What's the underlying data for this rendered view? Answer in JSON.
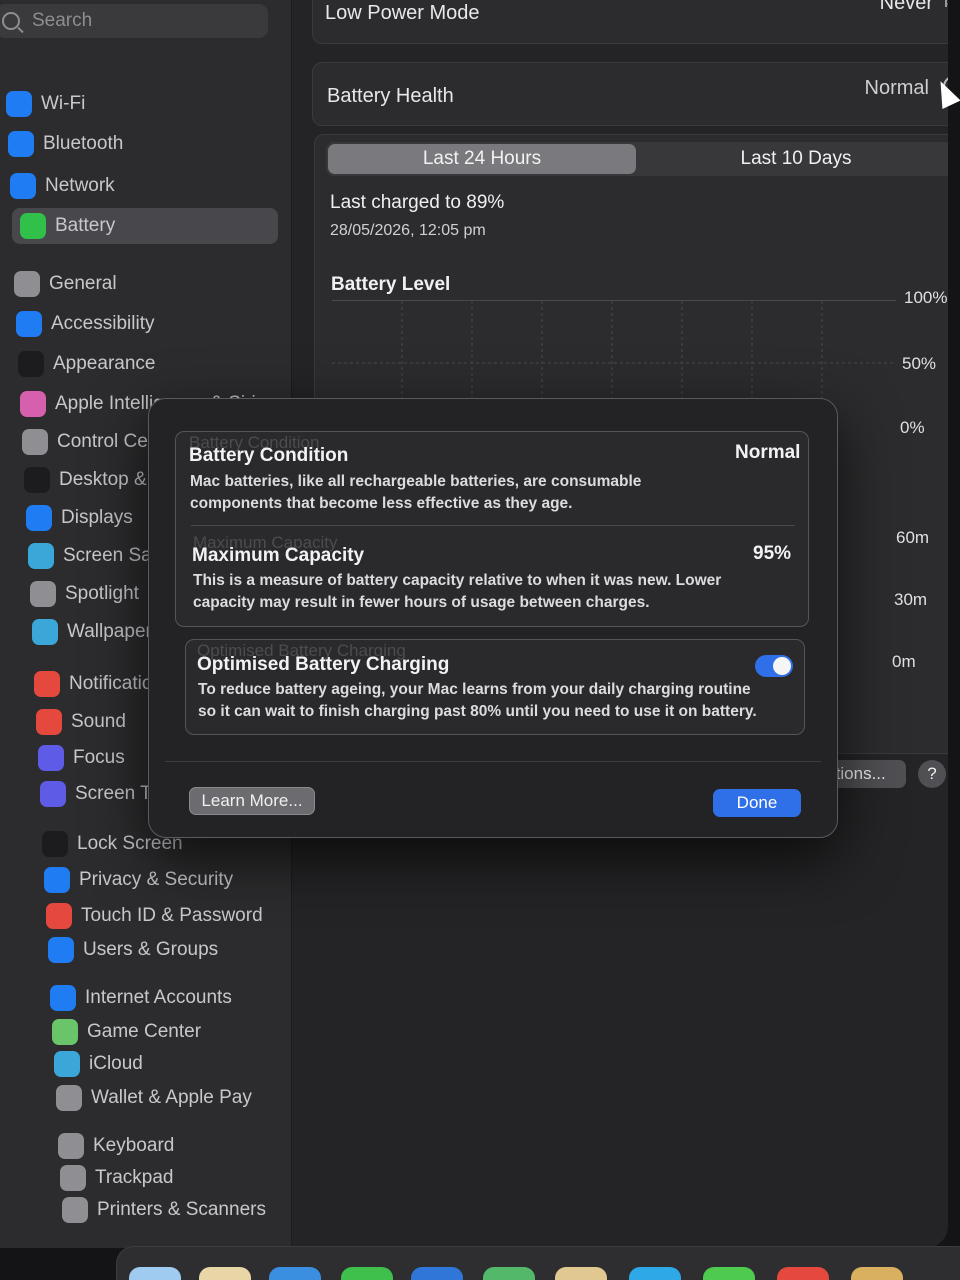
{
  "sidebar": {
    "search_placeholder": "Search",
    "items": [
      {
        "label": "Wi-Fi",
        "icon": "wifi-icon",
        "color": "#1f7cf2"
      },
      {
        "label": "Bluetooth",
        "icon": "bluetooth-icon",
        "color": "#1f7cf2"
      },
      {
        "label": "Network",
        "icon": "globe-icon",
        "color": "#1f7cf2"
      },
      {
        "label": "Battery",
        "icon": "battery-icon",
        "color": "#31c04a"
      },
      {
        "label": "General",
        "icon": "gear-icon",
        "color": "#8e8e93"
      },
      {
        "label": "Accessibility",
        "icon": "accessibility-icon",
        "color": "#1f7cf2"
      },
      {
        "label": "Appearance",
        "icon": "appearance-icon",
        "color": "#1c1c1e"
      },
      {
        "label": "Apple Intelligence & Siri",
        "icon": "siri-icon",
        "color": "#d65fae"
      },
      {
        "label": "Control Centre",
        "icon": "control-centre-icon",
        "color": "#8e8e93"
      },
      {
        "label": "Desktop & Dock",
        "icon": "desktop-dock-icon",
        "color": "#1c1c1e"
      },
      {
        "label": "Displays",
        "icon": "displays-icon",
        "color": "#1f7cf2"
      },
      {
        "label": "Screen Saver",
        "icon": "screen-saver-icon",
        "color": "#3aa7d8"
      },
      {
        "label": "Spotlight",
        "icon": "spotlight-icon",
        "color": "#8e8e93"
      },
      {
        "label": "Wallpaper",
        "icon": "wallpaper-icon",
        "color": "#3aa7d8"
      },
      {
        "label": "Notifications",
        "icon": "notifications-icon",
        "color": "#e5483d"
      },
      {
        "label": "Sound",
        "icon": "sound-icon",
        "color": "#e5483d"
      },
      {
        "label": "Focus",
        "icon": "focus-icon",
        "color": "#5e5ce6"
      },
      {
        "label": "Screen Time",
        "icon": "screen-time-icon",
        "color": "#5e5ce6"
      },
      {
        "label": "Lock Screen",
        "icon": "lock-icon",
        "color": "#1c1c1e"
      },
      {
        "label": "Privacy & Security",
        "icon": "hand-icon",
        "color": "#1f7cf2"
      },
      {
        "label": "Touch ID & Password",
        "icon": "fingerprint-icon",
        "color": "#e5483d"
      },
      {
        "label": "Users & Groups",
        "icon": "users-icon",
        "color": "#1f7cf2"
      },
      {
        "label": "Internet Accounts",
        "icon": "at-icon",
        "color": "#1f7cf2"
      },
      {
        "label": "Game Center",
        "icon": "game-center-icon",
        "color": "#6ac46a"
      },
      {
        "label": "iCloud",
        "icon": "icloud-icon",
        "color": "#3aa7d8"
      },
      {
        "label": "Wallet & Apple Pay",
        "icon": "wallet-icon",
        "color": "#8e8e93"
      },
      {
        "label": "Keyboard",
        "icon": "keyboard-icon",
        "color": "#8e8e93"
      },
      {
        "label": "Trackpad",
        "icon": "trackpad-icon",
        "color": "#8e8e93"
      },
      {
        "label": "Printers & Scanners",
        "icon": "printer-icon",
        "color": "#8e8e93"
      }
    ]
  },
  "main": {
    "low_power_label": "Low Power Mode",
    "low_power_value": "Never",
    "battery_health_label": "Battery Health",
    "battery_health_value": "Normal",
    "tabs": [
      "Last 24 Hours",
      "Last 10 Days"
    ],
    "last_charged": "Last charged to 89%",
    "last_charged_date": "28/05/2026, 12:05 pm",
    "battery_level_title": "Battery Level",
    "level_ticks": [
      "100%",
      "50%",
      "0%"
    ],
    "usage_ticks": [
      "60m",
      "30m",
      "0m"
    ],
    "options_label": "ptions...",
    "help_label": "?"
  },
  "modal": {
    "ghost_condition": "Battery Condition",
    "condition_title": "Battery Condition",
    "condition_value": "Normal",
    "condition_desc": "Mac batteries, like all rechargeable batteries, are consumable components that become less effective as they age.",
    "ghost_capacity": "Maximum Capacity",
    "capacity_title": "Maximum Capacity",
    "capacity_value": "95%",
    "capacity_desc": "This is a measure of battery capacity relative to when it was new. Lower capacity may result in fewer hours of usage between charges.",
    "ghost_charging": "Optimised Battery Charging",
    "charging_title": "Optimised Battery Charging",
    "charging_desc": "To reduce battery ageing, your Mac learns from your daily charging routine so it can wait to finish charging past 80% until you need to use it on battery.",
    "charging_enabled": true,
    "learn_more": "Learn More...",
    "done": "Done",
    "accent_color": "#2f6fe8"
  }
}
